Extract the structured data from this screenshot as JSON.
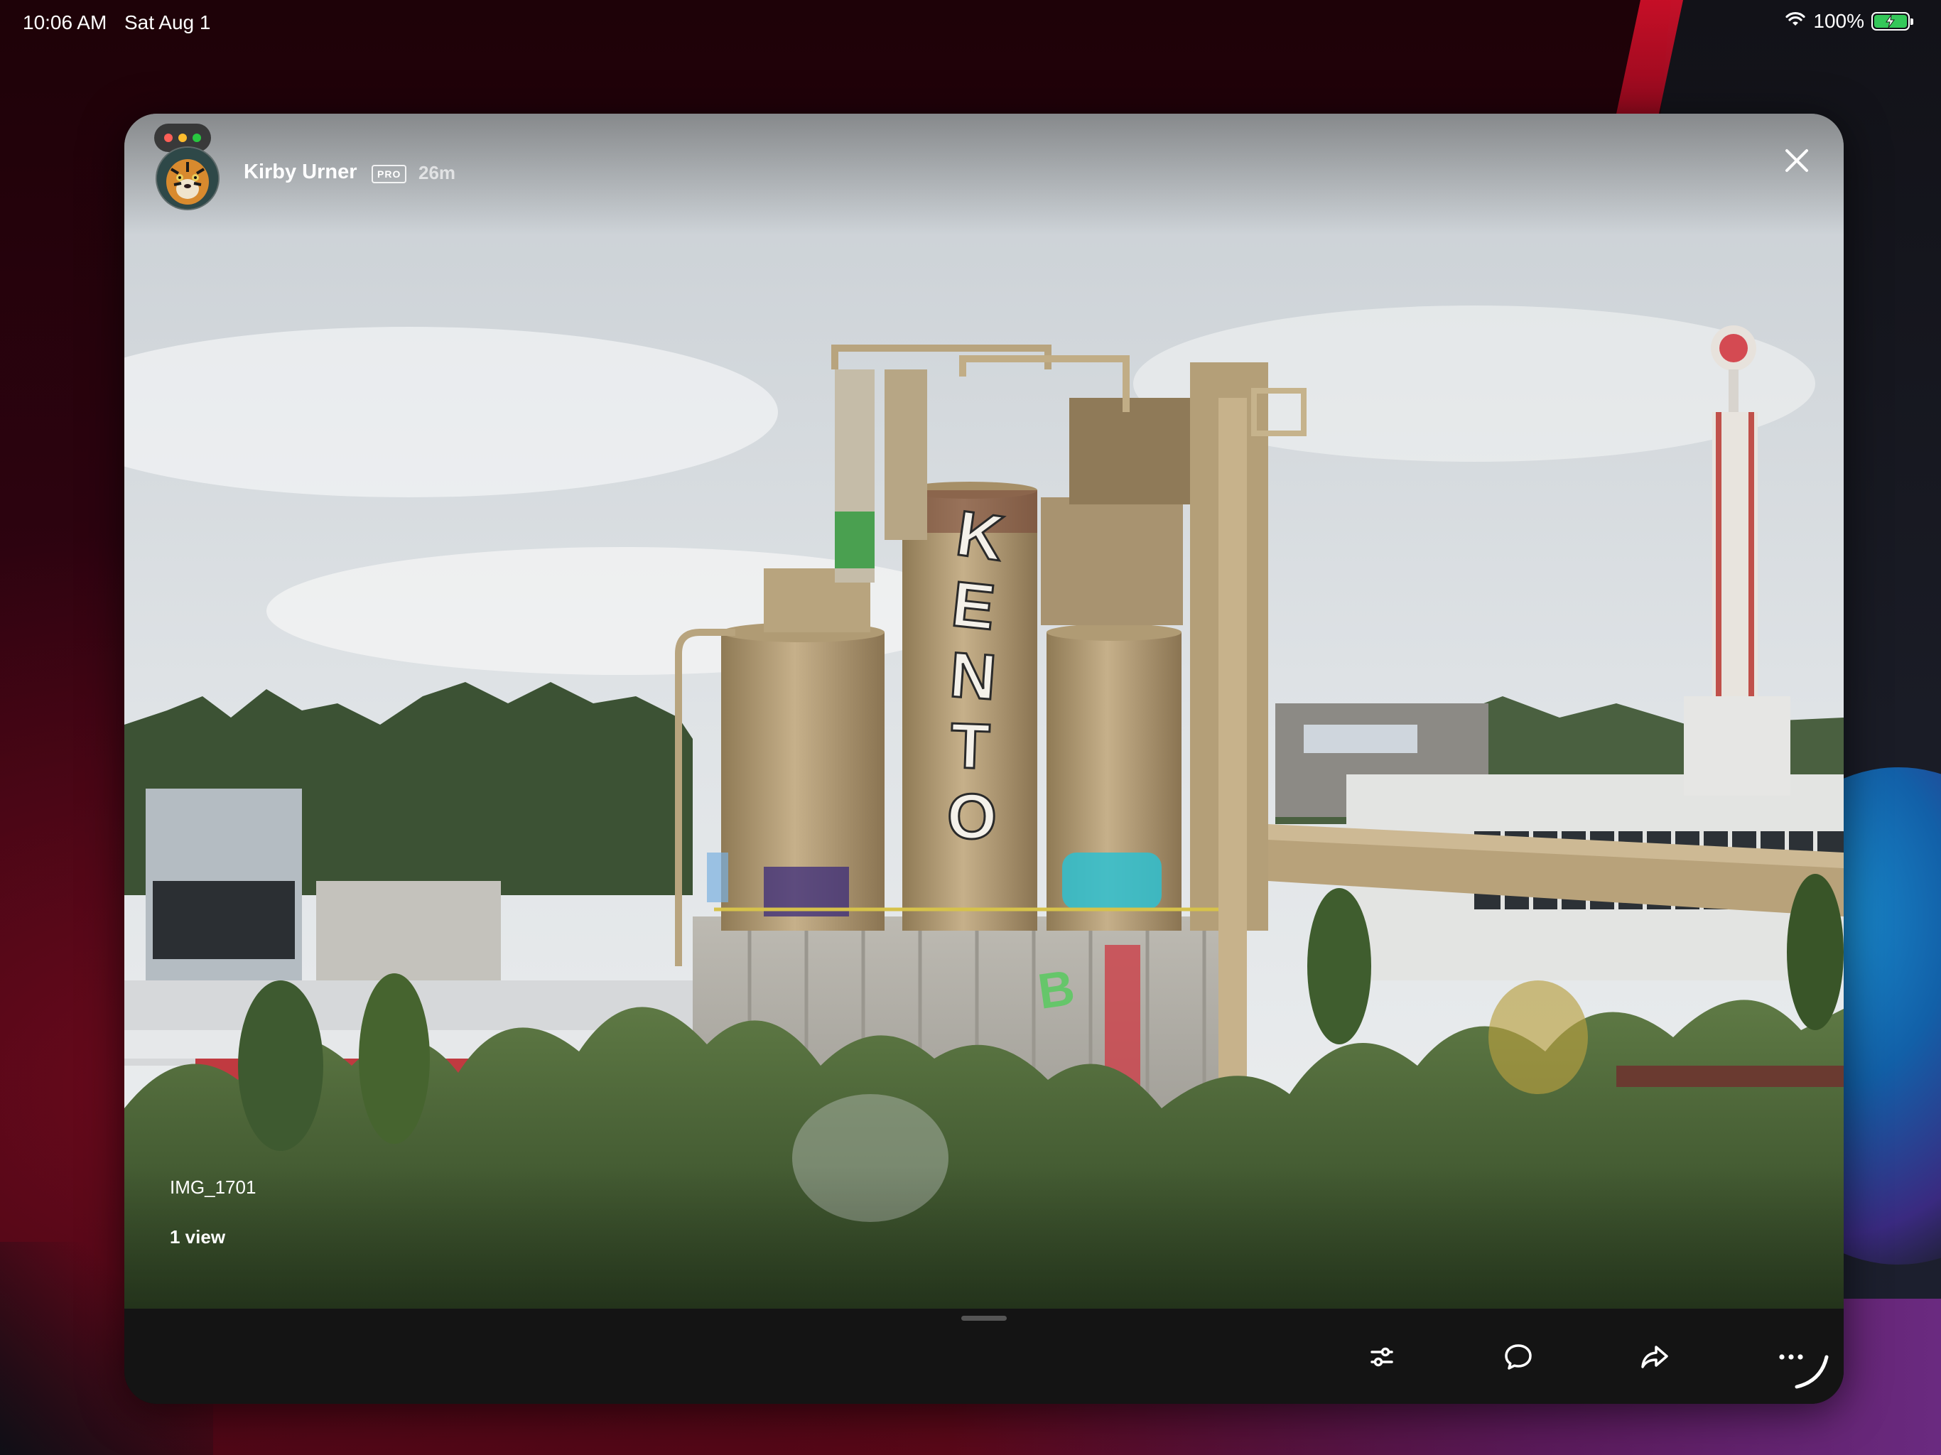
{
  "status_bar": {
    "time": "10:06 AM",
    "date": "Sat Aug 1",
    "battery": "100%",
    "wifi_icon": "wifi-icon",
    "battery_icon": "battery-charging-icon"
  },
  "window": {
    "controls": [
      "close-dot",
      "minimize-dot",
      "zoom-dot"
    ],
    "control_colors": [
      "#ff5f57",
      "#febc2e",
      "#28c840"
    ]
  },
  "post": {
    "user_name": "Kirby Urner",
    "badge": "PRO",
    "age": "26m",
    "photo_title": "IMG_1701",
    "views": "1 view"
  },
  "toolbar": {
    "icons": [
      "adjust-icon",
      "comment-icon",
      "share-icon",
      "more-icon"
    ]
  },
  "colors": {
    "toolbar_bg": "#141414",
    "battery_fill": "#34c759"
  }
}
